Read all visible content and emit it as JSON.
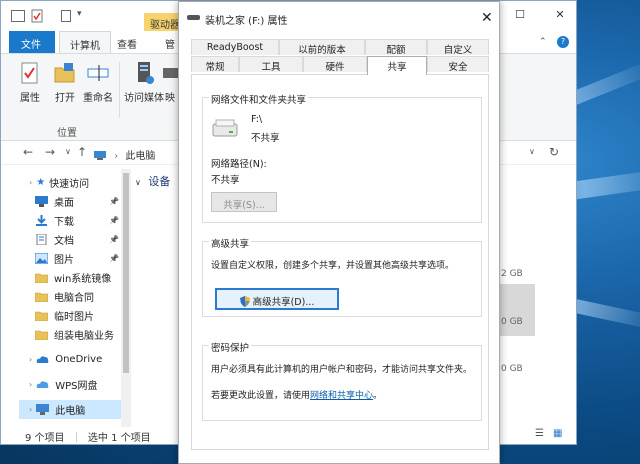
{
  "explorer": {
    "context_tab": "驱动器",
    "tabs": [
      "文件",
      "计算机",
      "查看",
      "管"
    ],
    "ribbon_buttons": [
      "属性",
      "打开",
      "重命名",
      "访问媒体",
      "映"
    ],
    "group_label": "位置",
    "address": "此电脑",
    "main_heading": "设备",
    "sidebar": {
      "quick_access": "快速访问",
      "items": [
        {
          "label": "桌面",
          "pinned": true,
          "icon": "desktop-icon"
        },
        {
          "label": "下载",
          "pinned": true,
          "icon": "download-icon"
        },
        {
          "label": "文档",
          "pinned": true,
          "icon": "documents-icon"
        },
        {
          "label": "图片",
          "pinned": true,
          "icon": "pictures-icon"
        },
        {
          "label": "win系统镜像",
          "pinned": false,
          "icon": "folder-icon"
        },
        {
          "label": "电脑合同",
          "pinned": false,
          "icon": "folder-icon"
        },
        {
          "label": "临时图片",
          "pinned": false,
          "icon": "folder-icon"
        },
        {
          "label": "组装电脑业务",
          "pinned": false,
          "icon": "folder-icon"
        }
      ],
      "onedrive": "OneDrive",
      "wps": "WPS网盘",
      "this_pc": "此电脑"
    },
    "right_sizes": [
      "2 GB",
      "0 GB",
      "0 GB"
    ],
    "status": {
      "count": "9 个项目",
      "selected": "选中 1 个项目"
    }
  },
  "dialog": {
    "title": "装机之家 (F:) 属性",
    "tabs_row1": [
      "ReadyBoost",
      "以前的版本",
      "配额",
      "自定义"
    ],
    "tabs_row2": [
      "常规",
      "工具",
      "硬件",
      "共享",
      "安全"
    ],
    "active_tab": "共享",
    "network_share": {
      "title": "网络文件和文件夹共享",
      "drive": "F:\\",
      "state": "不共享",
      "path_label": "网络路径(N):",
      "path_value": "不共享",
      "share_button": "共享(S)..."
    },
    "advanced_share": {
      "title": "高级共享",
      "desc": "设置自定义权限，创建多个共享，并设置其他高级共享选项。",
      "button": "高级共享(D)..."
    },
    "password": {
      "title": "密码保护",
      "desc": "用户必须具有此计算机的用户帐户和密码，才能访问共享文件夹。",
      "change_prefix": "若要更改此设置，请使用",
      "link": "网络和共享中心",
      "suffix": "。"
    }
  },
  "colors": {
    "accent": "#1979ca",
    "link": "#0b5cad",
    "folder": "#e8c15a"
  }
}
